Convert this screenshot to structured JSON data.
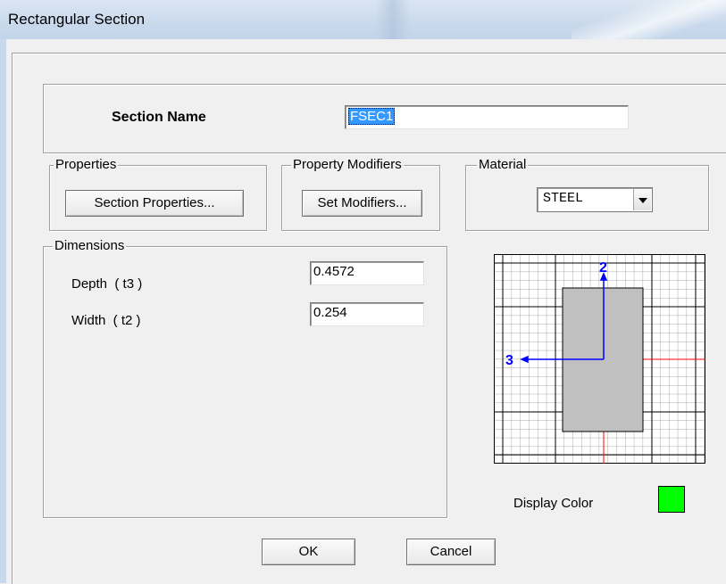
{
  "window": {
    "title": "Rectangular Section"
  },
  "section_name": {
    "label": "Section Name",
    "value": "FSEC1"
  },
  "properties": {
    "group_label": "Properties",
    "button_label": "Section Properties..."
  },
  "modifiers": {
    "group_label": "Property Modifiers",
    "button_label": "Set Modifiers..."
  },
  "material": {
    "group_label": "Material",
    "selected": "STEEL"
  },
  "dimensions": {
    "group_label": "Dimensions",
    "depth_label": "Depth  ( t3 )",
    "depth_value": "0.4572",
    "width_label": "Width  ( t2 )",
    "width_value": "0.254"
  },
  "preview": {
    "axis_vertical_label": "2",
    "axis_horizontal_label": "3",
    "section_fill": "#c0c0c0",
    "axis_color": "#0000ff",
    "centerline_color": "#ff0000"
  },
  "display_color": {
    "label": "Display Color",
    "color": "#00ff00"
  },
  "buttons": {
    "ok": "OK",
    "cancel": "Cancel"
  }
}
